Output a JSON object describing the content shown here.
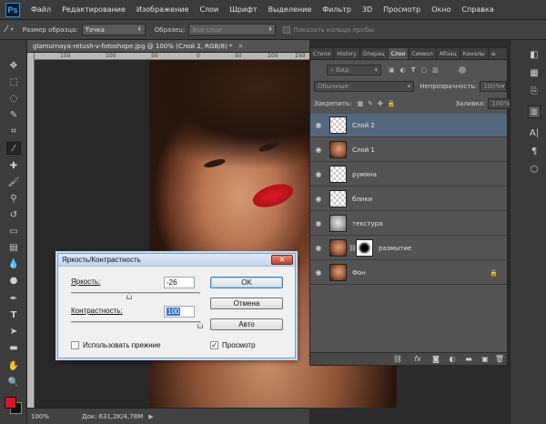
{
  "menubar": {
    "logo": "Ps",
    "items": [
      "Файл",
      "Редактирование",
      "Изображение",
      "Слои",
      "Шрифт",
      "Выделение",
      "Фильтр",
      "3D",
      "Просмотр",
      "Окно",
      "Справка"
    ]
  },
  "options": {
    "sample_size_label": "Размер образца:",
    "sample_size_value": "Точка",
    "sample_label": "Образец:",
    "sample_value": "Все слои",
    "show_ring_label": "Показать кольцо пробы"
  },
  "document": {
    "tab_title": "glamurnaya-retush-v-fotoshope.jpg @ 100% (Слой 2, RGB/8) *",
    "ruler_ticks": [
      "150",
      "100",
      "50",
      "0",
      "50",
      "100",
      "150"
    ],
    "zoom": "100%",
    "doc_size": "Док: 631,2K/4,78M"
  },
  "dialog": {
    "title": "Яркость/Контрастность",
    "brightness_label": "Яркость:",
    "brightness_value": "-26",
    "brightness_level": 0.45,
    "contrast_label": "Контрастность:",
    "contrast_value": "100",
    "contrast_level": 1.0,
    "ok_label": "OK",
    "cancel_label": "Отмена",
    "auto_label": "Авто",
    "use_legacy_label": "Использовать прежние",
    "use_legacy_checked": false,
    "preview_label": "Просмотр",
    "preview_checked": true
  },
  "layers_panel": {
    "tabs": [
      "Стили",
      "History",
      "Операц",
      "Слои",
      "Символ",
      "Абзац",
      "Каналы"
    ],
    "active_tab": "Слои",
    "kind_filter": "Вид",
    "blend_mode": "Обычные",
    "opacity_label": "Непрозрачность:",
    "opacity_value": "100%",
    "lock_label": "Закрепить:",
    "fill_label": "Заливка:",
    "fill_value": "100%",
    "layers": [
      {
        "name": "Слой 2",
        "thumb": "checker",
        "selected": true
      },
      {
        "name": "Слой 1",
        "thumb": "face",
        "selected": false
      },
      {
        "name": "румяна",
        "thumb": "checker",
        "selected": false
      },
      {
        "name": "блики",
        "thumb": "checker",
        "selected": false
      },
      {
        "name": "текстура",
        "thumb": "texture",
        "selected": false
      },
      {
        "name": "размытие",
        "thumb": "face",
        "mask": true,
        "selected": false
      },
      {
        "name": "Фон",
        "thumb": "face",
        "locked": true,
        "selected": false
      }
    ]
  },
  "colors": {
    "foreground": "#d8132c",
    "background": "#111111",
    "selected_layer": "#53687e"
  }
}
